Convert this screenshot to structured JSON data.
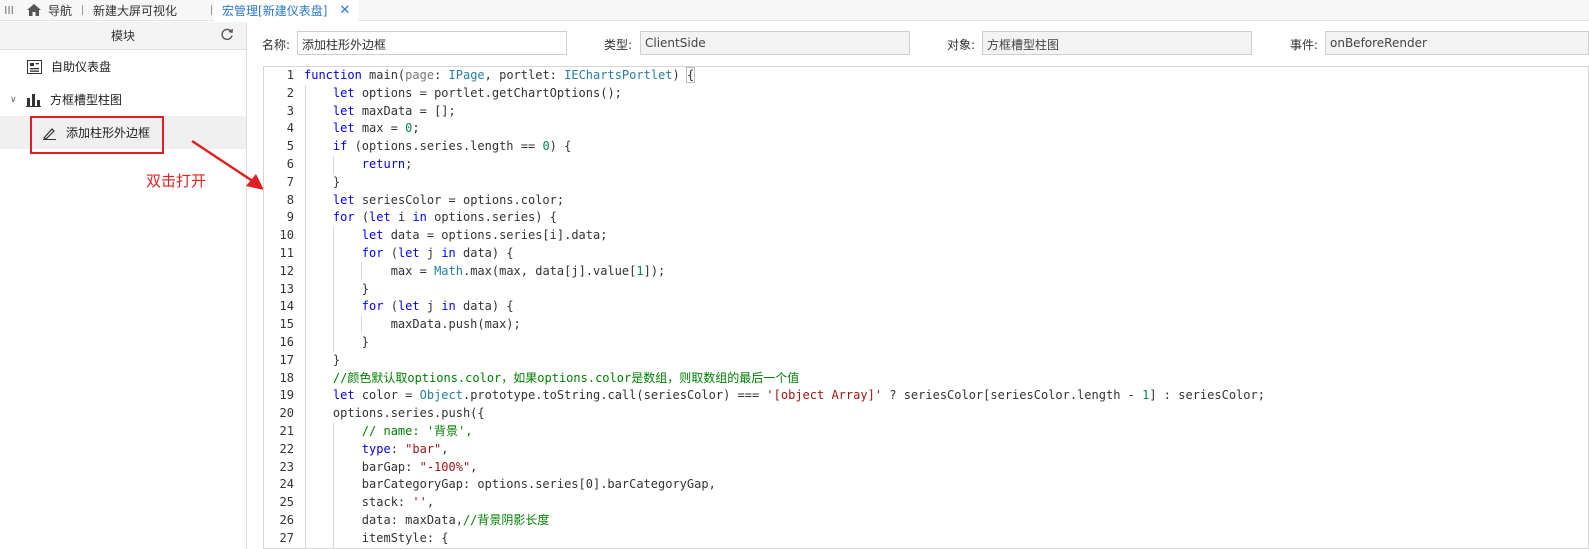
{
  "topbar": {
    "tabs": [
      {
        "label": "导航"
      },
      {
        "label": "新建大屏可视化"
      },
      {
        "label": "宏管理[新建仪表盘]"
      }
    ]
  },
  "leftpanel": {
    "title": "模块",
    "tree": [
      {
        "label": "自助仪表盘"
      },
      {
        "label": "方框槽型柱图"
      },
      {
        "label": "添加柱形外边框"
      }
    ],
    "annotation": "双击打开"
  },
  "form": {
    "name_label": "名称:",
    "name_value": "添加柱形外边框",
    "type_label": "类型:",
    "type_value": "ClientSide",
    "object_label": "对象:",
    "object_value": "方框槽型柱图",
    "event_label": "事件:",
    "event_value": "onBeforeRender"
  },
  "code_lines": [
    {
      "n": "1"
    },
    {
      "n": "2"
    },
    {
      "n": "3"
    },
    {
      "n": "4"
    },
    {
      "n": "5"
    },
    {
      "n": "6"
    },
    {
      "n": "7"
    },
    {
      "n": "8"
    },
    {
      "n": "9"
    },
    {
      "n": "10"
    },
    {
      "n": "11"
    },
    {
      "n": "12"
    },
    {
      "n": "13"
    },
    {
      "n": "14"
    },
    {
      "n": "15"
    },
    {
      "n": "16"
    },
    {
      "n": "17"
    },
    {
      "n": "18"
    },
    {
      "n": "19"
    },
    {
      "n": "20"
    },
    {
      "n": "21"
    },
    {
      "n": "22"
    },
    {
      "n": "23"
    },
    {
      "n": "24"
    },
    {
      "n": "25"
    },
    {
      "n": "26"
    },
    {
      "n": "27"
    }
  ],
  "code": {
    "l1_fn": "function",
    "l1_main": " main(",
    "l1_page": "page",
    "l1_colon1": ": ",
    "l1_ipage": "IPage",
    "l1_portlet": ", portlet: ",
    "l1_type": "IEChartsPortlet",
    "l1_end": ") ",
    "l1_brace": "{",
    "l2_let": "let",
    "l2_rest": " options = portlet.getChartOptions();",
    "l3_let": "let",
    "l3_rest": " maxData = [];",
    "l4_let": "let",
    "l4_rest": " max = ",
    "l4_num": "0",
    "l4_end": ";",
    "l5_if": "if",
    "l5_rest": " (options.series.length == ",
    "l5_num": "0",
    "l5_end": ") {",
    "l6_ret": "return",
    "l6_end": ";",
    "l7": "}",
    "l8_let": "let",
    "l8_rest": " seriesColor = options.color;",
    "l9_for": "for",
    "l9_a": " (",
    "l9_let": "let",
    "l9_b": " i ",
    "l9_in": "in",
    "l9_c": " options.series) {",
    "l10_let": "let",
    "l10_rest": " data = options.series[i].data;",
    "l11_for": "for",
    "l11_a": " (",
    "l11_let": "let",
    "l11_b": " j ",
    "l11_in": "in",
    "l11_c": " data) {",
    "l12_a": "max = ",
    "l12_math": "Math",
    "l12_b": ".max(max, data[j].value[",
    "l12_num": "1",
    "l12_c": "]);",
    "l13": "}",
    "l14_for": "for",
    "l14_a": " (",
    "l14_let": "let",
    "l14_b": " j ",
    "l14_in": "in",
    "l14_c": " data) {",
    "l15": "maxData.push(max);",
    "l16": "}",
    "l17": "}",
    "l18": "//颜色默认取options.color，如果options.color是数组，则取数组的最后一个值",
    "l19_let": "let",
    "l19_a": " color = ",
    "l19_obj": "Object",
    "l19_b": ".prototype.toString.call(seriesColor) === ",
    "l19_str": "'[object Array]'",
    "l19_c": " ? seriesColor[seriesColor.length - ",
    "l19_num": "1",
    "l19_d": "] : seriesColor;",
    "l20": "options.series.push({",
    "l21": "// name: '背景',",
    "l22_key": "type",
    "l22_a": ": ",
    "l22_str": "\"bar\"",
    "l22_b": ",",
    "l23_a": "barGap: ",
    "l23_str": "\"-100%\"",
    "l23_b": ",",
    "l24": "barCategoryGap: options.series[0].barCategoryGap,",
    "l25_a": "stack: ",
    "l25_str": "''",
    "l25_b": ",",
    "l26_a": "data: maxData,",
    "l26_cm": "//背景阴影长度",
    "l27": "itemStyle: {"
  }
}
